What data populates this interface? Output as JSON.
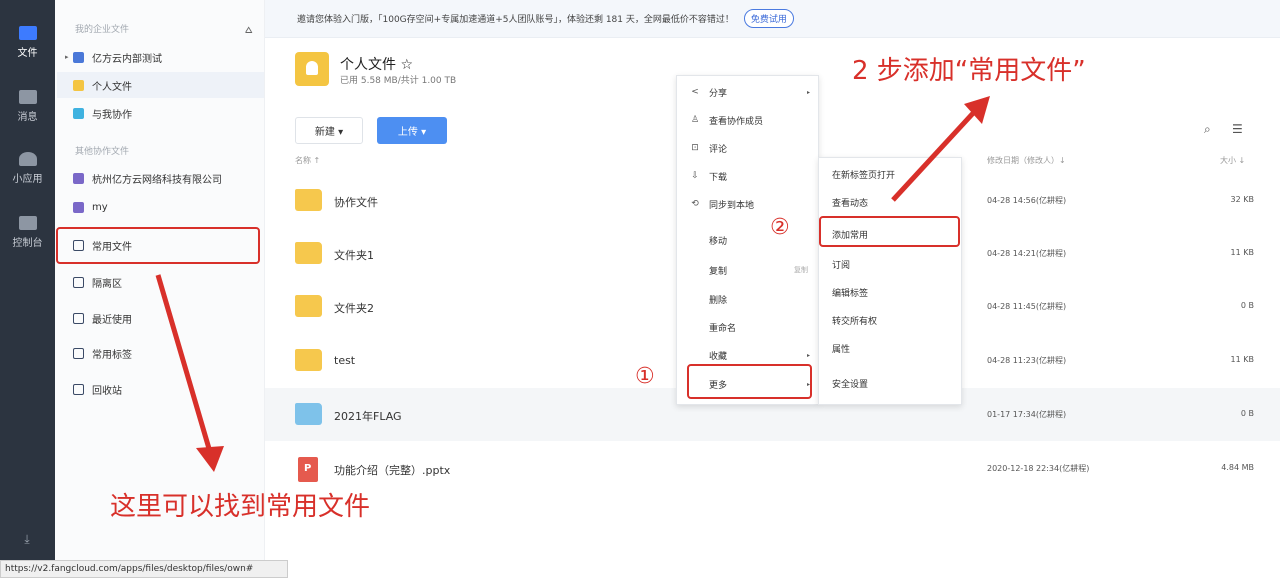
{
  "rail": {
    "items": [
      {
        "label": "文件"
      },
      {
        "label": "消息"
      },
      {
        "label": "小应用"
      },
      {
        "label": "控制台"
      }
    ],
    "download_icon": "download-icon"
  },
  "sidebar": {
    "section_enterprise": "我的企业文件",
    "items_top": [
      {
        "label": "亿方云内部测试"
      },
      {
        "label": "个人文件"
      },
      {
        "label": "与我协作"
      }
    ],
    "section_other": "其他协作文件",
    "items_mid": [
      {
        "label": "杭州亿方云网络科技有限公司"
      },
      {
        "label": "my"
      }
    ],
    "items_bottom": [
      {
        "label": "常用文件"
      },
      {
        "label": "隔离区"
      },
      {
        "label": "最近使用"
      },
      {
        "label": "常用标签"
      },
      {
        "label": "回收站"
      }
    ]
  },
  "banner": {
    "text": "邀请您体验入门版，「100G存空间+专属加速通道+5人团队账号」，体验还剩 181 天，全网最低价不容错过！",
    "button": "免费试用"
  },
  "folder": {
    "title": "个人文件 ☆",
    "usage": "已用 5.58 MB/共计 1.00 TB"
  },
  "toolbar": {
    "new_label": "新建 ▾",
    "upload_label": "上传 ▾",
    "search_icon": "search-icon",
    "list_icon": "list-view-icon"
  },
  "columns": {
    "name": "名称 ↑",
    "modified": "修改日期（修改人）↓",
    "size": "大小 ↓"
  },
  "files": [
    {
      "name": "协作文件",
      "date": "04-28 14:56(亿耕程)",
      "size": "32 KB"
    },
    {
      "name": "文件夹1",
      "date": "04-28 14:21(亿耕程)",
      "size": "11 KB"
    },
    {
      "name": "文件夹2",
      "date": "04-28 11:45(亿耕程)",
      "size": "0 B"
    },
    {
      "name": "test",
      "date": "04-28 11:23(亿耕程)",
      "size": "11 KB"
    },
    {
      "name": "2021年FLAG",
      "date": "01-17 17:34(亿耕程)",
      "size": "0 B"
    },
    {
      "name": "功能介绍（完整）.pptx",
      "date": "2020-12-18 22:34(亿耕程)",
      "size": "4.84 MB"
    }
  ],
  "context_menu": {
    "items": [
      {
        "icon": "<",
        "label": "分享",
        "has_sub": true
      },
      {
        "icon": "♙",
        "label": "查看协作成员"
      },
      {
        "icon": "⊡",
        "label": "评论"
      },
      {
        "icon": "⇩",
        "label": "下载"
      },
      {
        "icon": "⟲",
        "label": "同步到本地"
      },
      {
        "icon": "",
        "label": "移动"
      },
      {
        "icon": "",
        "label": "复制",
        "shortcut": "复制"
      },
      {
        "icon": "",
        "label": "删除"
      },
      {
        "icon": "",
        "label": "重命名"
      },
      {
        "icon": "",
        "label": "收藏",
        "has_sub": true
      },
      {
        "icon": "",
        "label": "更多",
        "has_sub": true
      }
    ]
  },
  "submenu": {
    "items": [
      {
        "label": "在新标签页打开"
      },
      {
        "label": "查看动态"
      },
      {
        "label": "添加常用"
      },
      {
        "label": "订阅"
      },
      {
        "label": "编辑标签"
      },
      {
        "label": "转交所有权"
      },
      {
        "label": "属性"
      },
      {
        "label": "安全设置"
      }
    ]
  },
  "annotations": {
    "step2": "2 步添加“常用文件”",
    "bottom": "这里可以找到常用文件",
    "circle1": "①",
    "circle2": "②",
    "color": "#d8302a"
  },
  "status_url": "https://v2.fangcloud.com/apps/files/desktop/files/own#"
}
